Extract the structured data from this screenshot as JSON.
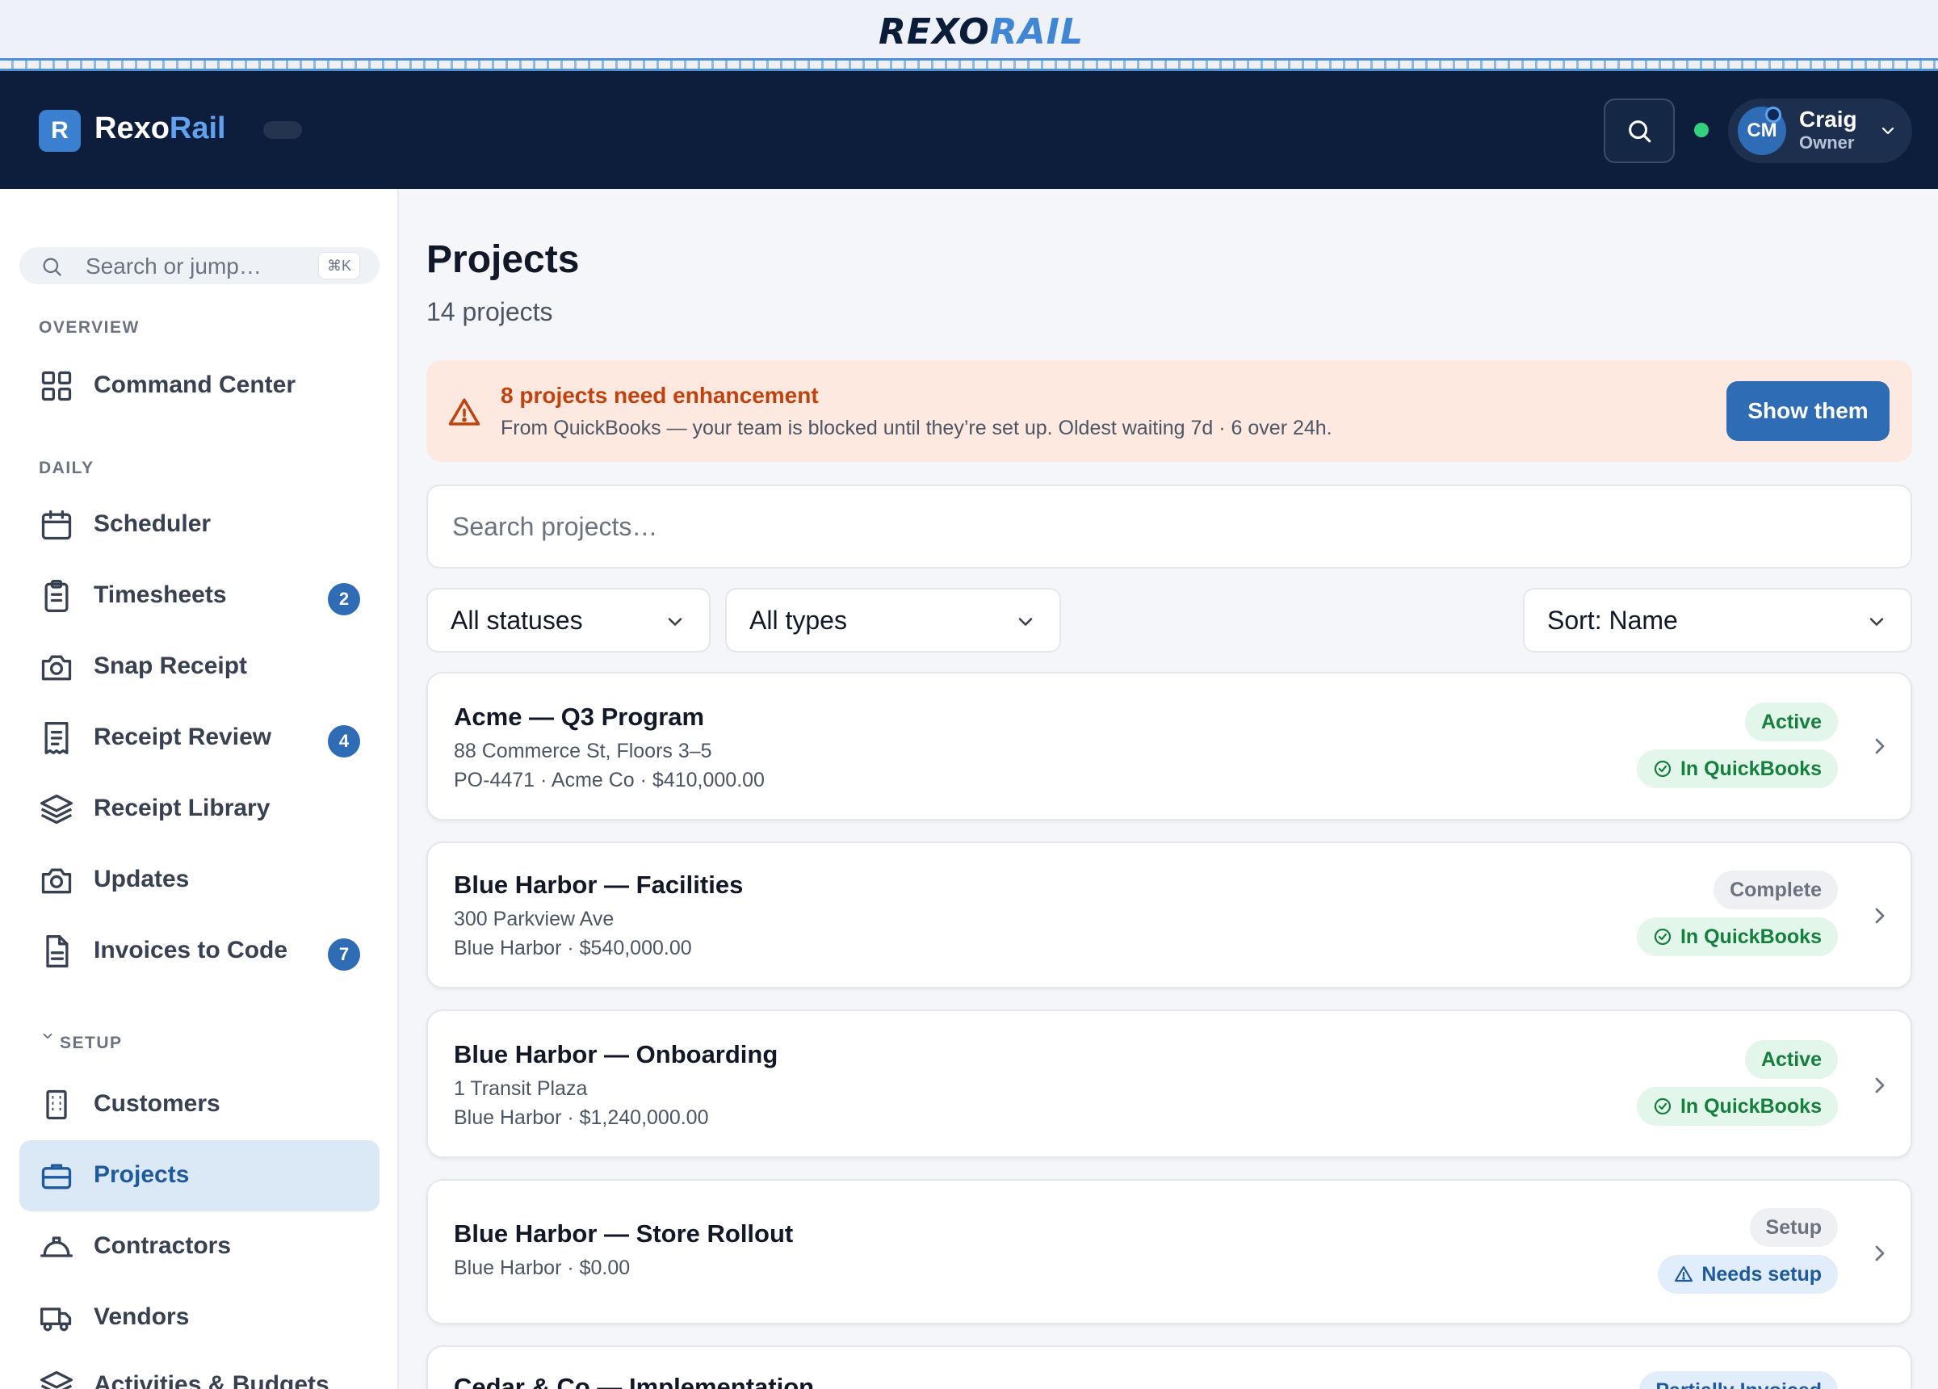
{
  "brand": {
    "part1": "REXO",
    "part2": "RAIL"
  },
  "header": {
    "app_name_a": "Rexo",
    "app_name_b": "Rail",
    "logo_letter": "R",
    "user": {
      "initials": "CM",
      "name": "Craig",
      "role": "Owner"
    }
  },
  "sidebar": {
    "search_placeholder": "Search or jump…",
    "shortcut": "⌘K",
    "sections": {
      "overview": "OVERVIEW",
      "daily": "DAILY",
      "setup": "SETUP"
    },
    "items": [
      {
        "label": "Command Center",
        "icon": "grid-icon"
      },
      {
        "label": "Scheduler",
        "icon": "calendar-icon"
      },
      {
        "label": "Timesheets",
        "icon": "clipboard-icon",
        "badge": "2"
      },
      {
        "label": "Snap Receipt",
        "icon": "camera-icon"
      },
      {
        "label": "Receipt Review",
        "icon": "receipt-icon",
        "badge": "4"
      },
      {
        "label": "Receipt Library",
        "icon": "layers-icon"
      },
      {
        "label": "Updates",
        "icon": "camera-icon"
      },
      {
        "label": "Invoices to Code",
        "icon": "file-icon",
        "badge": "7"
      },
      {
        "label": "Customers",
        "icon": "building-icon"
      },
      {
        "label": "Projects",
        "icon": "briefcase-icon",
        "active": true
      },
      {
        "label": "Contractors",
        "icon": "hard-hat-icon"
      },
      {
        "label": "Vendors",
        "icon": "truck-icon"
      },
      {
        "label": "Activities & Budgets",
        "icon": "layers-icon"
      }
    ]
  },
  "main": {
    "title": "Projects",
    "subtitle": "14 projects",
    "alert": {
      "title": "8 projects need enhancement",
      "body": "From QuickBooks — your team is blocked until they’re set up. Oldest waiting 7d · 6 over 24h.",
      "button": "Show them"
    },
    "search_placeholder": "Search projects…",
    "filters": {
      "status": "All statuses",
      "type": "All types",
      "sort": "Sort: Name"
    },
    "projects": [
      {
        "name": "Acme — Q3 Program",
        "address": "88 Commerce St, Floors 3–5",
        "meta": "PO-4471 · Acme Co · $410,000.00",
        "status": "Active",
        "qb": "In QuickBooks"
      },
      {
        "name": "Blue Harbor — Facilities",
        "address": "300 Parkview Ave",
        "meta": "Blue Harbor · $540,000.00",
        "status": "Complete",
        "qb": "In QuickBooks"
      },
      {
        "name": "Blue Harbor — Onboarding",
        "address": "1 Transit Plaza",
        "meta": "Blue Harbor · $1,240,000.00",
        "status": "Active",
        "qb": "In QuickBooks"
      },
      {
        "name": "Blue Harbor — Store Rollout",
        "meta": "Blue Harbor · $0.00",
        "status": "Setup",
        "qb": "Needs setup"
      },
      {
        "name": "Cedar & Co — Implementation",
        "status": "Partially Invoiced"
      }
    ]
  },
  "colors": {
    "navy": "#0c1e3b",
    "accent": "#2f6cb6",
    "green": "#15803d",
    "warning": "#c2410c"
  }
}
